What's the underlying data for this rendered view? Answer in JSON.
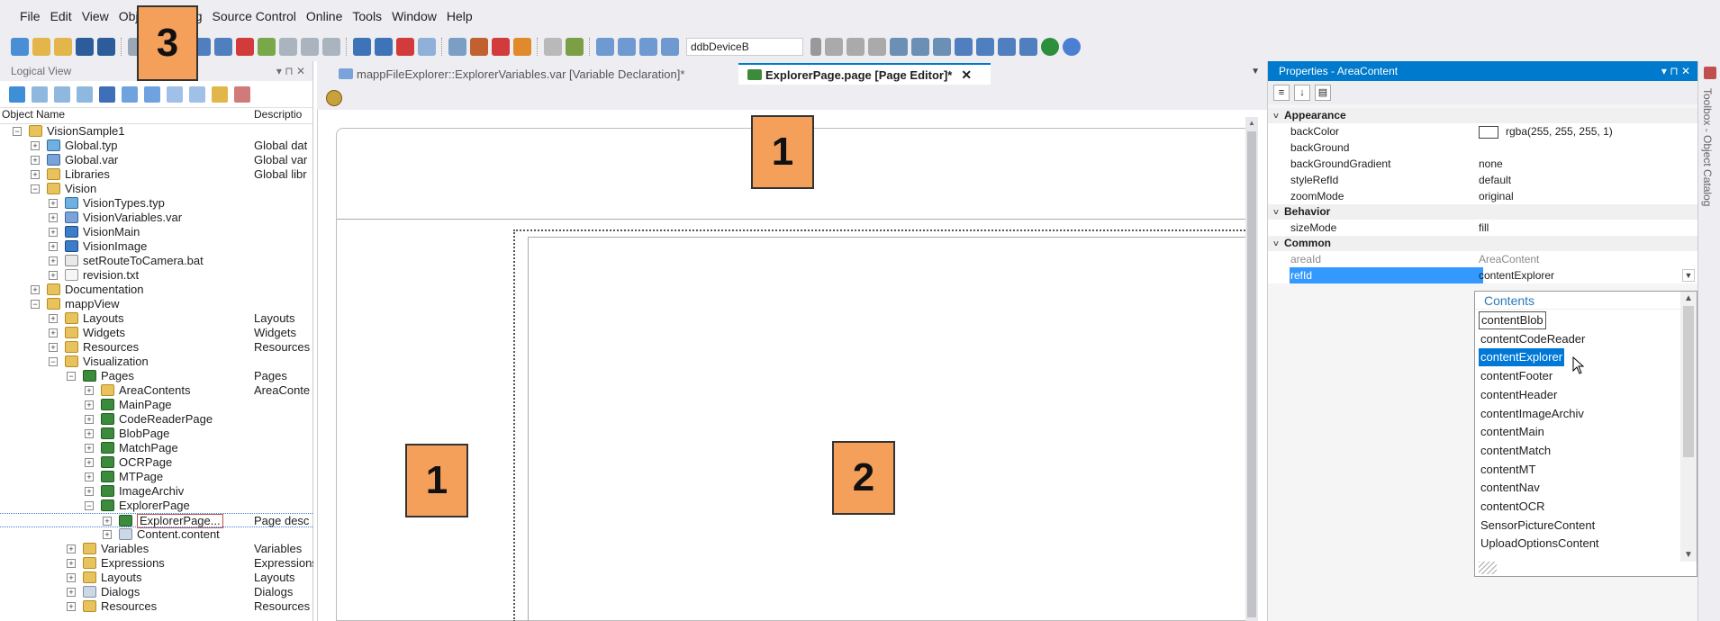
{
  "menu": [
    "File",
    "Edit",
    "View",
    "Object",
    "Debug",
    "Source Control",
    "Online",
    "Tools",
    "Window",
    "Help"
  ],
  "toolbar": {
    "device_combo": "ddbDeviceB"
  },
  "left_panel": {
    "title": "Logical View",
    "col_name": "Object Name",
    "col_desc": "Descriptio",
    "tree": [
      {
        "label": "VisionSample1",
        "desc": "",
        "level": 0,
        "icon": "folder-icon",
        "exp": "−"
      },
      {
        "label": "Global.typ",
        "desc": "Global dat",
        "level": 1,
        "icon": "type-icon",
        "exp": "+"
      },
      {
        "label": "Global.var",
        "desc": "Global var",
        "level": 1,
        "icon": "variable-icon",
        "exp": "+"
      },
      {
        "label": "Libraries",
        "desc": "Global libr",
        "level": 1,
        "icon": "folder-icon",
        "exp": "+"
      },
      {
        "label": "Vision",
        "desc": "",
        "level": 1,
        "icon": "folder-icon",
        "exp": "−"
      },
      {
        "label": "VisionTypes.typ",
        "desc": "",
        "level": 2,
        "icon": "type-icon",
        "exp": "+"
      },
      {
        "label": "VisionVariables.var",
        "desc": "",
        "level": 2,
        "icon": "variable-icon",
        "exp": "+"
      },
      {
        "label": "VisionMain",
        "desc": "",
        "level": 2,
        "icon": "vision-program-icon",
        "exp": "+"
      },
      {
        "label": "VisionImage",
        "desc": "",
        "level": 2,
        "icon": "vision-program-icon",
        "exp": "+"
      },
      {
        "label": "setRouteToCamera.bat",
        "desc": "",
        "level": 2,
        "icon": "batch-file-icon",
        "exp": "+"
      },
      {
        "label": "revision.txt",
        "desc": "",
        "level": 2,
        "icon": "text-file-icon",
        "exp": "+"
      },
      {
        "label": "Documentation",
        "desc": "",
        "level": 1,
        "icon": "folder-icon",
        "exp": "+"
      },
      {
        "label": "mappView",
        "desc": "",
        "level": 1,
        "icon": "folder-icon",
        "exp": "−"
      },
      {
        "label": "Layouts",
        "desc": "Layouts",
        "level": 2,
        "icon": "folder-icon",
        "exp": "+"
      },
      {
        "label": "Widgets",
        "desc": "Widgets",
        "level": 2,
        "icon": "folder-icon",
        "exp": "+"
      },
      {
        "label": "Resources",
        "desc": "Resources",
        "level": 2,
        "icon": "folder-icon",
        "exp": "+"
      },
      {
        "label": "Visualization",
        "desc": "",
        "level": 2,
        "icon": "folder-icon",
        "exp": "−"
      },
      {
        "label": "Pages",
        "desc": "Pages",
        "level": 3,
        "icon": "pages-icon",
        "exp": "−"
      },
      {
        "label": "AreaContents",
        "desc": "AreaConte",
        "level": 4,
        "icon": "folder-icon",
        "exp": "+"
      },
      {
        "label": "MainPage",
        "desc": "",
        "level": 4,
        "icon": "page-icon",
        "exp": "+"
      },
      {
        "label": "CodeReaderPage",
        "desc": "",
        "level": 4,
        "icon": "page-icon",
        "exp": "+"
      },
      {
        "label": "BlobPage",
        "desc": "",
        "level": 4,
        "icon": "page-icon",
        "exp": "+"
      },
      {
        "label": "MatchPage",
        "desc": "",
        "level": 4,
        "icon": "page-icon",
        "exp": "+"
      },
      {
        "label": "OCRPage",
        "desc": "",
        "level": 4,
        "icon": "page-icon",
        "exp": "+"
      },
      {
        "label": "MTPage",
        "desc": "",
        "level": 4,
        "icon": "page-icon",
        "exp": "+"
      },
      {
        "label": "ImageArchiv",
        "desc": "",
        "level": 4,
        "icon": "page-icon",
        "exp": "+"
      },
      {
        "label": "ExplorerPage",
        "desc": "",
        "level": 4,
        "icon": "page-icon",
        "exp": "−"
      },
      {
        "label": "ExplorerPage...",
        "desc": "Page desc",
        "level": 5,
        "icon": "page-icon",
        "exp": "+",
        "selected": true
      },
      {
        "label": "Content.content",
        "desc": "",
        "level": 5,
        "icon": "file-icon",
        "exp": "+"
      },
      {
        "label": "Variables",
        "desc": "Variables",
        "level": 3,
        "icon": "folder-icon",
        "exp": "+"
      },
      {
        "label": "Expressions",
        "desc": "Expressions",
        "level": 3,
        "icon": "folder-icon",
        "exp": "+"
      },
      {
        "label": "Layouts",
        "desc": "Layouts",
        "level": 3,
        "icon": "folder-icon",
        "exp": "+"
      },
      {
        "label": "Dialogs",
        "desc": "Dialogs",
        "level": 3,
        "icon": "file-icon",
        "exp": "+"
      },
      {
        "label": "Resources",
        "desc": "Resources",
        "level": 3,
        "icon": "folder-icon",
        "exp": "+"
      }
    ]
  },
  "editor": {
    "tabs": [
      {
        "label": "mappFileExplorer::ExplorerVariables.var [Variable Declaration]*",
        "active": false
      },
      {
        "label": "ExplorerPage.page [Page Editor]*",
        "active": true
      }
    ],
    "close_glyph": "✕"
  },
  "badges": {
    "top": "1",
    "left": "1",
    "center": "2",
    "menu_overlay": "3"
  },
  "properties": {
    "title": "Properties - AreaContent",
    "categories": [
      {
        "name": "Appearance",
        "rows": [
          {
            "name": "backColor",
            "value": "rgba(255, 255, 255, 1)",
            "swatch": true
          },
          {
            "name": "backGround",
            "value": ""
          },
          {
            "name": "backGroundGradient",
            "value": "none"
          },
          {
            "name": "styleRefId",
            "value": "default"
          },
          {
            "name": "zoomMode",
            "value": "original"
          }
        ]
      },
      {
        "name": "Behavior",
        "rows": [
          {
            "name": "sizeMode",
            "value": "fill"
          }
        ]
      },
      {
        "name": "Common",
        "rows": [
          {
            "name": "areaId",
            "value": "AreaContent",
            "readonly": true
          },
          {
            "name": "refId",
            "value": "contentExplorer",
            "selected": true,
            "dropdown": true
          }
        ]
      }
    ]
  },
  "refid_dropdown": {
    "header": "Contents",
    "items": [
      "contentBlob",
      "contentCodeReader",
      "contentExplorer",
      "contentFooter",
      "contentHeader",
      "contentImageArchiv",
      "contentMain",
      "contentMatch",
      "contentMT",
      "contentNav",
      "contentOCR",
      "SensorPictureContent",
      "UploadOptionsContent"
    ],
    "focused": "contentBlob",
    "selected": "contentExplorer"
  },
  "toolbox_strip": {
    "label": "Toolbox - Object Catalog"
  },
  "colors": {
    "accent": "#007acc",
    "badge": "#f5a05a",
    "selection": "#0078d7"
  }
}
